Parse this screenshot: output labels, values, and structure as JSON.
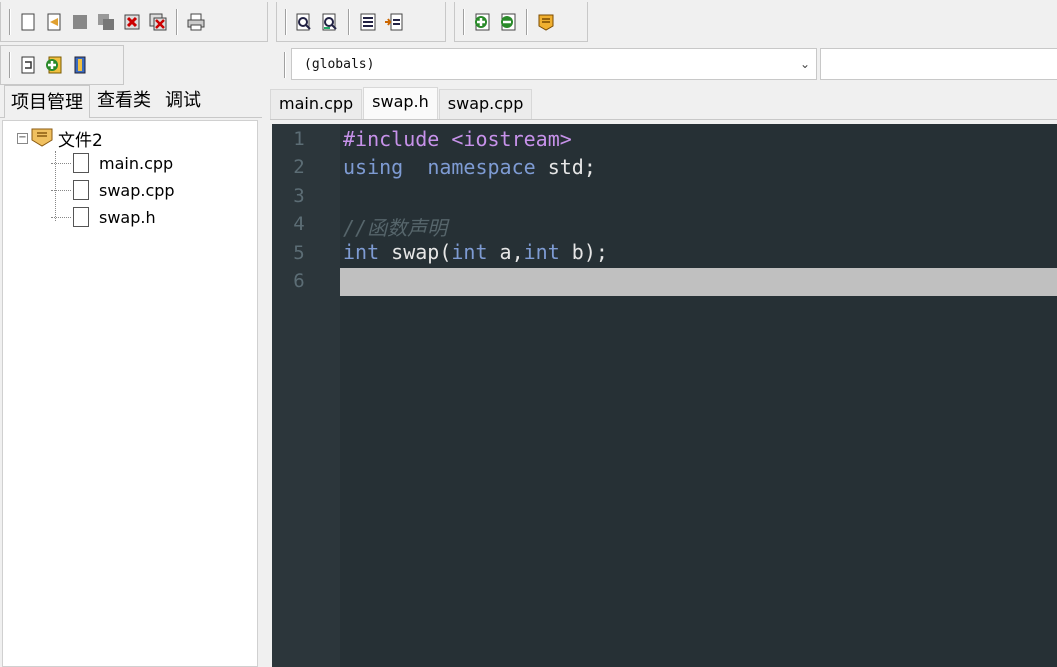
{
  "toolbar": {
    "icons": [
      "new-file-icon",
      "open-file-icon",
      "save-icon",
      "save-all-icon",
      "close-icon",
      "close-all-icon",
      "print-icon",
      "find-icon",
      "replace-icon",
      "indent-icon",
      "unindent-icon",
      "add-bookmark-icon",
      "remove-bookmark-icon",
      "goto-bookmark-icon"
    ]
  },
  "toolbar2": {
    "icons": [
      "toggle-icon",
      "add-project-icon",
      "debug-icon"
    ]
  },
  "combos": {
    "scope": "(globals)",
    "member": ""
  },
  "left_tabs": [
    "项目管理",
    "查看类",
    "调试"
  ],
  "tree": {
    "root": "文件2",
    "children": [
      "main.cpp",
      "swap.cpp",
      "swap.h"
    ]
  },
  "editor_tabs": [
    "main.cpp",
    "swap.h",
    "swap.cpp"
  ],
  "active_tab": "swap.h",
  "code": {
    "line_numbers": [
      "1",
      "2",
      "3",
      "4",
      "5",
      "6"
    ],
    "lines": {
      "l1": "#include <iostream>",
      "l2a": "using",
      "l2b": "namespace",
      "l2c": " std;",
      "l4": "//函数声明",
      "l5a": "int",
      "l5b": " swap(",
      "l5c": "int",
      "l5d": " a,",
      "l5e": "int",
      "l5f": " b);"
    }
  },
  "colors": {
    "editor_bg": "#263035",
    "keyword": "#c792ea",
    "type": "#7e9bd3",
    "comment": "#56656b",
    "current_line": "#c0c0c0"
  }
}
